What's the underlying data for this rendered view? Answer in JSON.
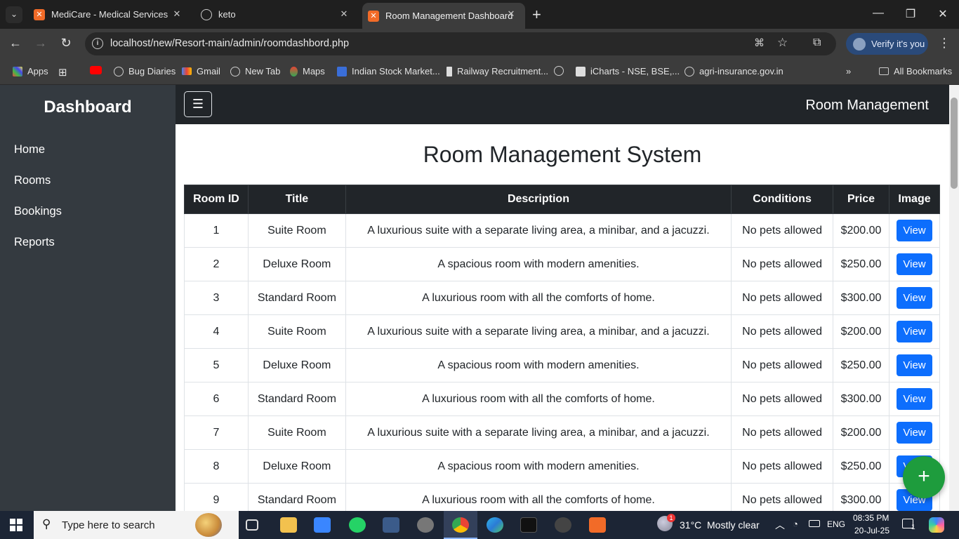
{
  "browser": {
    "tabs": [
      {
        "title": "MediCare - Medical Services",
        "active": false
      },
      {
        "title": "keto",
        "active": false
      },
      {
        "title": "Room Management Dashboard",
        "active": true
      }
    ],
    "url": "localhost/new/Resort-main/admin/roomdashbord.php",
    "verify_label": "Verify it's you",
    "bookmarks": [
      "Apps",
      "Bug Diaries",
      "Gmail",
      "New Tab",
      "Maps",
      "Indian Stock Market...",
      "Railway Recruitment...",
      "iCharts - NSE, BSE,...",
      "agri-insurance.gov.in"
    ],
    "all_bookmarks": "All Bookmarks"
  },
  "sidebar": {
    "brand": "Dashboard",
    "items": [
      {
        "label": "Home"
      },
      {
        "label": "Rooms"
      },
      {
        "label": "Bookings"
      },
      {
        "label": "Reports"
      }
    ]
  },
  "topnav": {
    "toggle": "☰",
    "title": "Room Management"
  },
  "main": {
    "title": "Room Management System",
    "columns": [
      "Room ID",
      "Title",
      "Description",
      "Conditions",
      "Price",
      "Image"
    ],
    "rows": [
      {
        "id": "1",
        "title": "Suite Room",
        "description": "A luxurious suite with a separate living area, a minibar, and a jacuzzi.",
        "conditions": "No pets allowed",
        "price": "$200.00",
        "action": "View"
      },
      {
        "id": "2",
        "title": "Deluxe Room",
        "description": "A spacious room with modern amenities.",
        "conditions": "No pets allowed",
        "price": "$250.00",
        "action": "View"
      },
      {
        "id": "3",
        "title": "Standard Room",
        "description": "A luxurious room with all the comforts of home.",
        "conditions": "No pets allowed",
        "price": "$300.00",
        "action": "View"
      },
      {
        "id": "4",
        "title": "Suite Room",
        "description": "A luxurious suite with a separate living area, a minibar, and a jacuzzi.",
        "conditions": "No pets allowed",
        "price": "$200.00",
        "action": "View"
      },
      {
        "id": "5",
        "title": "Deluxe Room",
        "description": "A spacious room with modern amenities.",
        "conditions": "No pets allowed",
        "price": "$250.00",
        "action": "View"
      },
      {
        "id": "6",
        "title": "Standard Room",
        "description": "A luxurious room with all the comforts of home.",
        "conditions": "No pets allowed",
        "price": "$300.00",
        "action": "View"
      },
      {
        "id": "7",
        "title": "Suite Room",
        "description": "A luxurious suite with a separate living area, a minibar, and a jacuzzi.",
        "conditions": "No pets allowed",
        "price": "$200.00",
        "action": "View"
      },
      {
        "id": "8",
        "title": "Deluxe Room",
        "description": "A spacious room with modern amenities.",
        "conditions": "No pets allowed",
        "price": "$250.00",
        "action": "View"
      },
      {
        "id": "9",
        "title": "Standard Room",
        "description": "A luxurious room with all the comforts of home.",
        "conditions": "No pets allowed",
        "price": "$300.00",
        "action": "View"
      }
    ],
    "fab": "+"
  },
  "taskbar": {
    "search_placeholder": "Type here to search",
    "weather": "31°C",
    "weather_text": "Mostly clear",
    "lang": "ENG",
    "time": "08:35 PM",
    "date": "20-Jul-25",
    "notif_count": "1",
    "weather_badge": "1"
  },
  "colors": {
    "sidebar": "#343a40",
    "topnav": "#212529",
    "primary": "#0d6efd",
    "fab": "#1e9c3d"
  }
}
